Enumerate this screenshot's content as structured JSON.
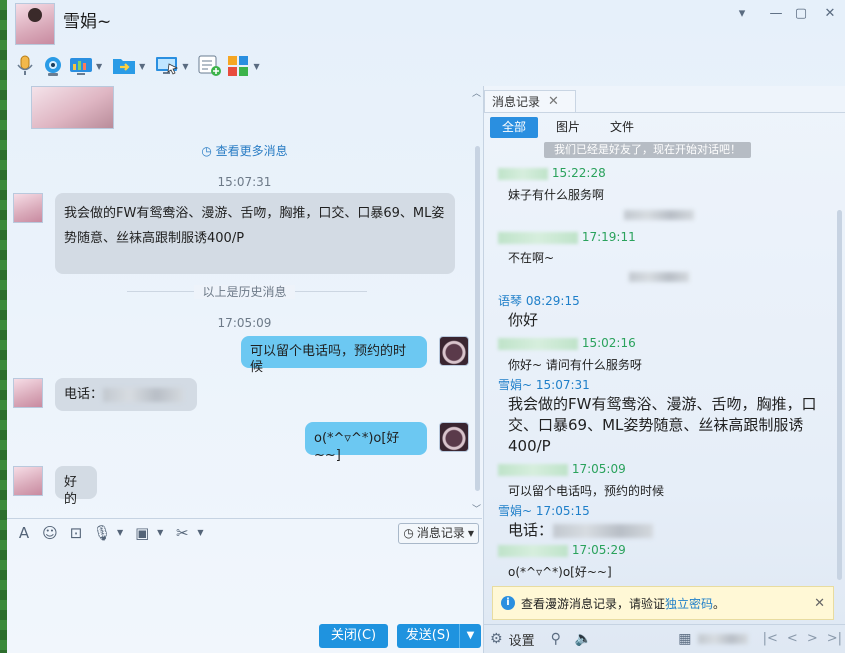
{
  "window": {
    "contact_name": "雪娟~",
    "controls": [
      "▾",
      "—",
      "▢",
      "✕"
    ]
  },
  "toolbar": {
    "items": [
      {
        "icon": "microphone-icon",
        "has_menu": false
      },
      {
        "icon": "webcam-icon",
        "has_menu": false
      },
      {
        "icon": "app-chart-icon",
        "has_menu": true
      },
      {
        "icon": "file-transfer-icon",
        "has_menu": true
      },
      {
        "icon": "remote-desktop-icon",
        "has_menu": true
      },
      {
        "icon": "add-message-icon",
        "has_menu": false
      },
      {
        "icon": "apps-grid-icon",
        "has_menu": true
      }
    ]
  },
  "chat": {
    "more_messages": "查看更多消息",
    "history_divider": "以上是历史消息",
    "messages": [
      {
        "time": "15:07:31",
        "from": "her",
        "text": "我会做的FW有鸳鸯浴、漫游、舌吻，胸推，口交、口暴69、ML姿势随意、丝袜高跟制服诱400/P"
      },
      {
        "time": "17:05:09",
        "from": "me",
        "text": "可以留个电话吗，预约的时候"
      },
      {
        "from": "her",
        "text": "电话："
      },
      {
        "from": "me",
        "text": "o(*^▿^*)o[好~~]"
      },
      {
        "from": "her",
        "text": "好的"
      }
    ]
  },
  "input_bar": {
    "history_button": "消息记录",
    "icons": [
      "font-icon",
      "emoji-icon",
      "screenshot-icon",
      "voice-icon",
      "image-icon",
      "scissors-icon"
    ]
  },
  "actions": {
    "close": "关闭(C)",
    "send": "发送(S)"
  },
  "history_panel": {
    "tab_label": "消息记录",
    "filters": [
      "全部",
      "图片",
      "文件"
    ],
    "system_text": "我们已经是好友了，现在开始对话吧！",
    "entries": [
      {
        "name": "",
        "time": "15:22:28",
        "color": "g",
        "text": "妹子有什么服务啊",
        "big": false
      },
      {
        "date_sep": true
      },
      {
        "name": "",
        "time": "17:19:11",
        "color": "g",
        "text": "不在啊~",
        "big": false
      },
      {
        "date_sep": true
      },
      {
        "name": "语琴",
        "time": "08:29:15",
        "color": "b",
        "text": "你好",
        "big": true
      },
      {
        "name": "",
        "time": "15:02:16",
        "color": "g",
        "text": "你好~ 请问有什么服务呀",
        "big": false
      },
      {
        "name": "雪娟~",
        "time": "15:07:31",
        "color": "b",
        "text": "我会做的FW有鸳鸯浴、漫游、舌吻，胸推，口交、口暴69、ML姿势随意、丝袜高跟制服诱400/P",
        "big": true
      },
      {
        "name": "",
        "time": "17:05:09",
        "color": "g",
        "text": "可以留个电话吗，预约的时候",
        "big": false
      },
      {
        "name": "雪娟~",
        "time": "17:05:15",
        "color": "b",
        "text": "电话：",
        "big": true
      },
      {
        "name": "",
        "time": "17:05:29",
        "color": "g",
        "text": "o(*^▿^*)o[好~~]",
        "big": false
      }
    ],
    "notice_text": "查看漫游消息记录，请验证",
    "notice_link": "独立密码",
    "notice_end": "。",
    "settings": "设置"
  },
  "colors": {
    "accent": "#1f93df",
    "bubble_out": "#6cc8f2",
    "bubble_in": "#d3dbe4"
  }
}
